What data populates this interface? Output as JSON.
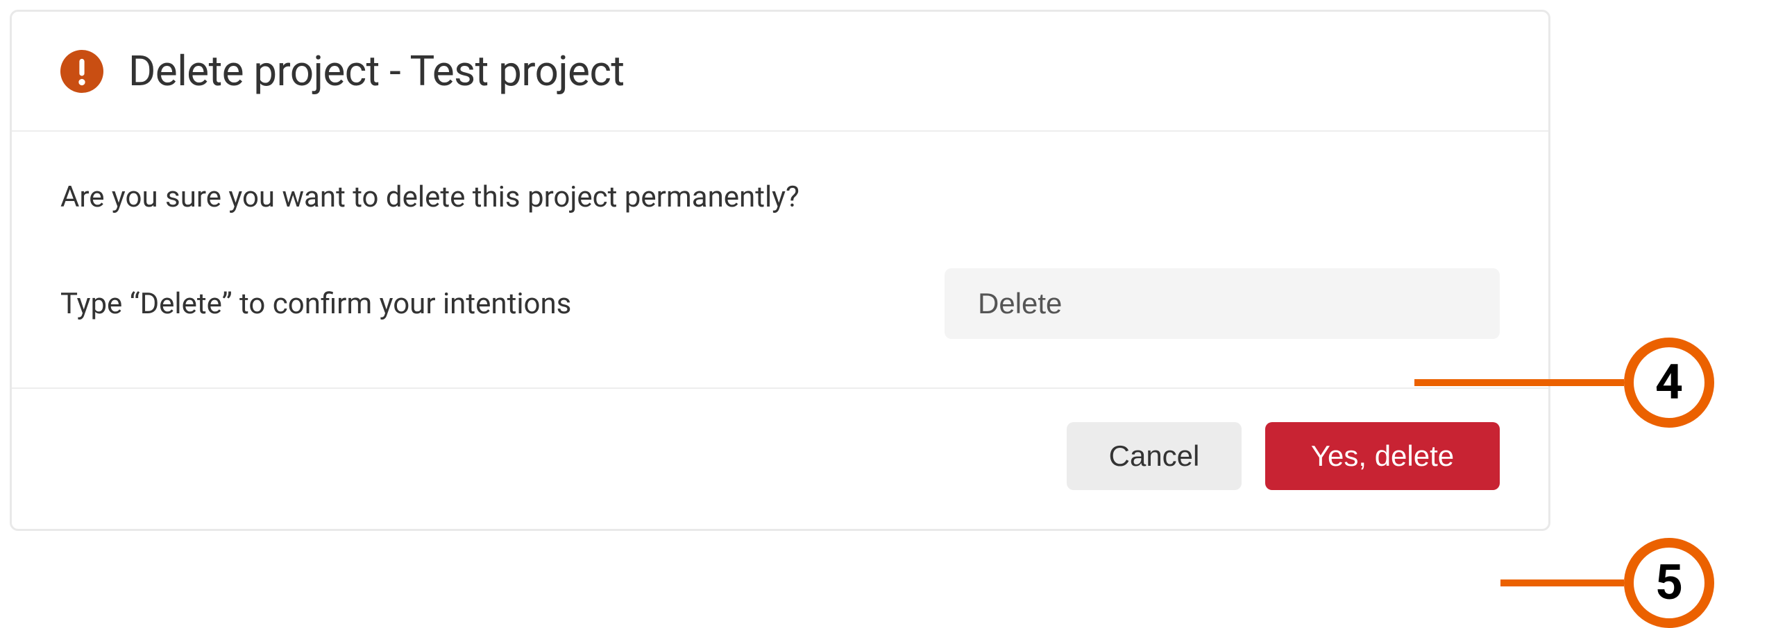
{
  "dialog": {
    "title": "Delete project - Test project",
    "question": "Are you sure you want to delete this project permanently?",
    "confirm_label": "Type “Delete” to confirm your intentions",
    "input_value": "Delete",
    "cancel_label": "Cancel",
    "delete_label": "Yes, delete"
  },
  "callouts": {
    "step4": "4",
    "step5": "5"
  },
  "colors": {
    "warning_icon": "#c94e12",
    "danger_button": "#c82333",
    "callout_accent": "#eb6100"
  }
}
